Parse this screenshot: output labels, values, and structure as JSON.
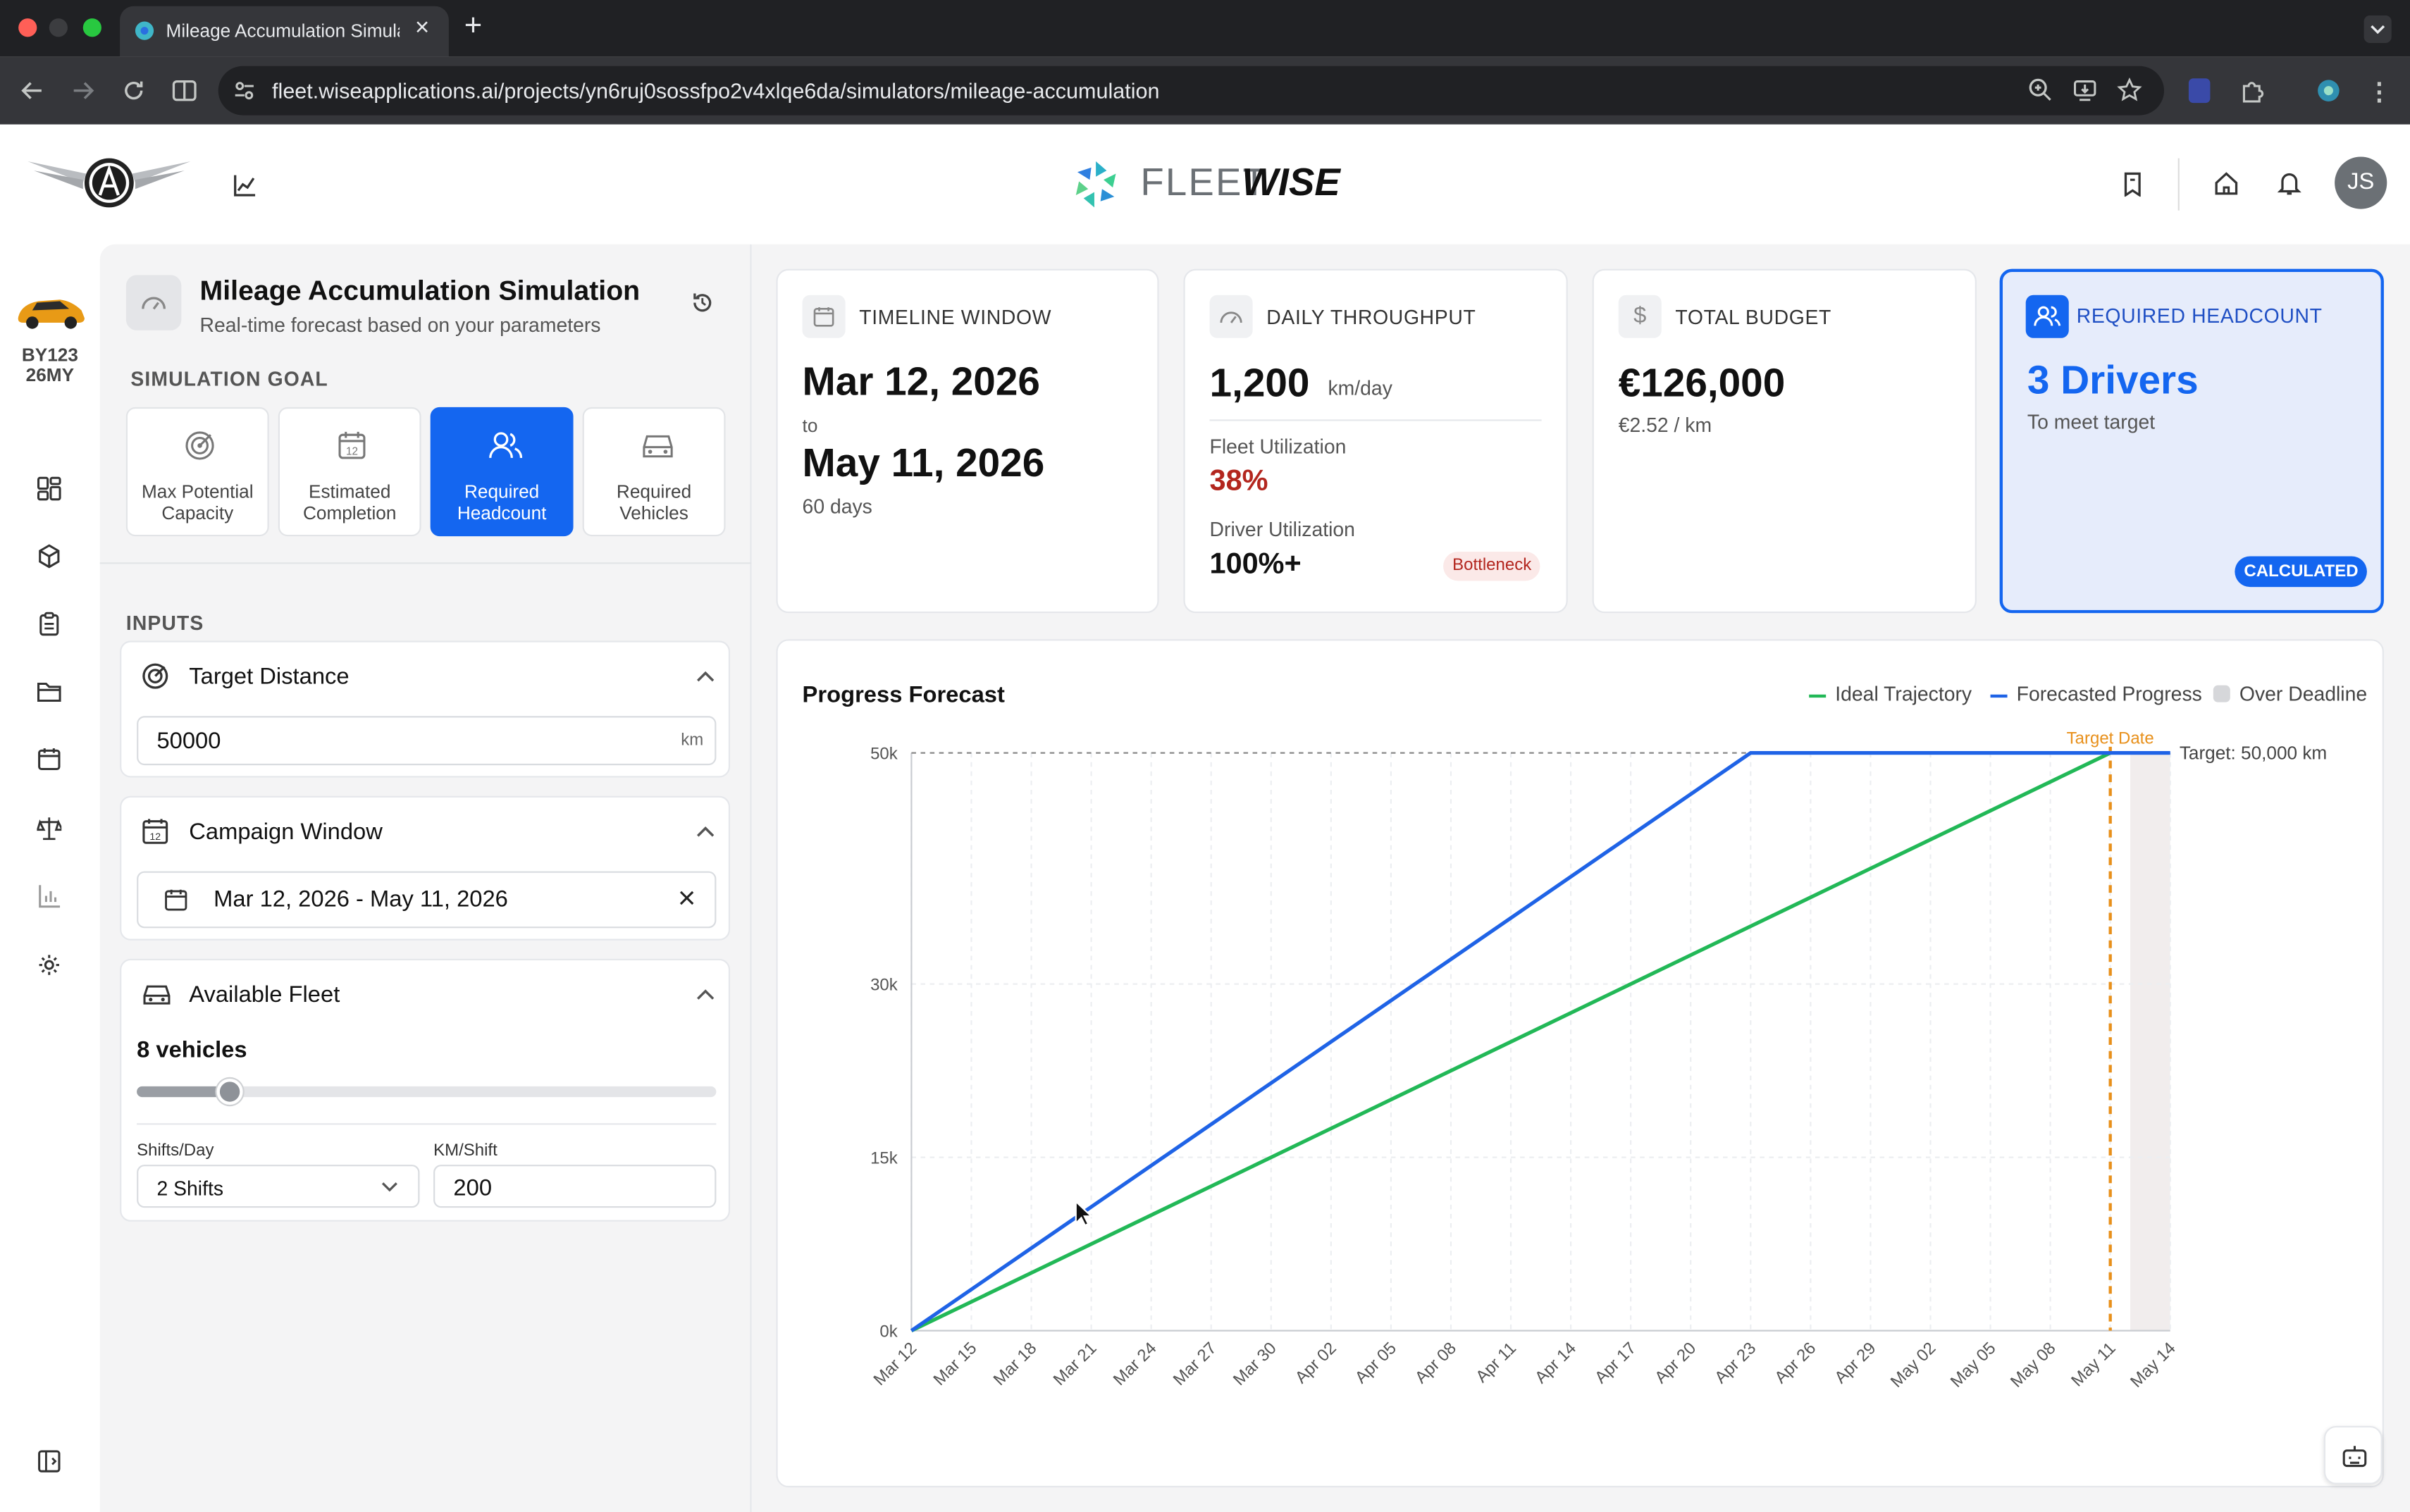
{
  "browser": {
    "tab_title": "Mileage Accumulation Simula",
    "url": "fleet.wiseapplications.ai/projects/yn6ruj0sossfpo2v4xlqe6da/simulators/mileage-accumulation"
  },
  "header": {
    "brand_light": "FLEET",
    "brand_bold": "WISE",
    "avatar_initials": "JS"
  },
  "vehicle": {
    "id_line1": "BY123",
    "id_line2": "26MY"
  },
  "panel": {
    "title": "Mileage Accumulation Simulation",
    "subtitle": "Real-time forecast based on your parameters",
    "goal_label": "SIMULATION GOAL",
    "goals": [
      {
        "label_1": "Max Potential",
        "label_2": "Capacity",
        "icon": "target-icon",
        "active": false
      },
      {
        "label_1": "Estimated",
        "label_2": "Completion",
        "icon": "calendar-icon",
        "active": false
      },
      {
        "label_1": "Required",
        "label_2": "Headcount",
        "icon": "users-icon",
        "active": true
      },
      {
        "label_1": "Required",
        "label_2": "Vehicles",
        "icon": "car-icon",
        "active": false
      }
    ],
    "inputs_label": "INPUTS",
    "target_distance": {
      "title": "Target Distance",
      "value": "50000",
      "unit": "km"
    },
    "campaign_window": {
      "title": "Campaign Window",
      "value": "Mar 12, 2026 - May 11, 2026"
    },
    "available_fleet": {
      "title": "Available Fleet",
      "vehicles_label": "8 vehicles",
      "slider_fraction": 0.16,
      "shifts_label": "Shifts/Day",
      "shifts_value": "2 Shifts",
      "km_label": "KM/Shift",
      "km_value": "200"
    }
  },
  "kpis": {
    "timeline": {
      "title": "TIMELINE WINDOW",
      "start": "Mar 12, 2026",
      "to": "to",
      "end": "May 11, 2026",
      "days": "60 days"
    },
    "throughput": {
      "title": "DAILY THROUGHPUT",
      "value": "1,200",
      "unit": "km/day",
      "fleet_label": "Fleet Utilization",
      "fleet_value": "38%",
      "driver_label": "Driver Utilization",
      "driver_value": "100%+",
      "badge": "Bottleneck"
    },
    "budget": {
      "title": "TOTAL BUDGET",
      "value": "€126,000",
      "sub": "€2.52 / km"
    },
    "headcount": {
      "title": "REQUIRED HEADCOUNT",
      "value": "3 Drivers",
      "sub": "To meet target",
      "badge": "CALCULATED"
    }
  },
  "colors": {
    "primary": "#1466f0",
    "ideal": "#22b857",
    "forecast": "#1f63e6",
    "deadline": "#e8901b",
    "danger": "#b3261e"
  },
  "chart_data": {
    "type": "line",
    "title": "Progress Forecast",
    "x": [
      "Mar 12",
      "Mar 15",
      "Mar 18",
      "Mar 21",
      "Mar 24",
      "Mar 27",
      "Mar 30",
      "Apr 02",
      "Apr 05",
      "Apr 08",
      "Apr 11",
      "Apr 14",
      "Apr 17",
      "Apr 20",
      "Apr 23",
      "Apr 26",
      "Apr 29",
      "May 02",
      "May 05",
      "May 08",
      "May 11",
      "May 14"
    ],
    "y_ticks": [
      "0k",
      "15k",
      "30k",
      "50k"
    ],
    "y_tick_values": [
      0,
      15000,
      30000,
      50000
    ],
    "ylim": [
      0,
      50000
    ],
    "x_day_range": [
      0,
      63
    ],
    "series": [
      {
        "name": "Ideal Trajectory",
        "points": [
          [
            0,
            0
          ],
          [
            60,
            50000
          ]
        ]
      },
      {
        "name": "Forecasted Progress",
        "points": [
          [
            0,
            0
          ],
          [
            42,
            50000
          ],
          [
            63,
            50000
          ]
        ]
      }
    ],
    "legend": [
      "Ideal Trajectory",
      "Forecasted Progress",
      "Over Deadline"
    ],
    "legend_position": "top-right",
    "target_date_label": "Target Date",
    "target_date_day": 60,
    "target_line_label": "Target: 50,000 km",
    "target_value": 50000,
    "over_deadline_from_day": 61
  }
}
